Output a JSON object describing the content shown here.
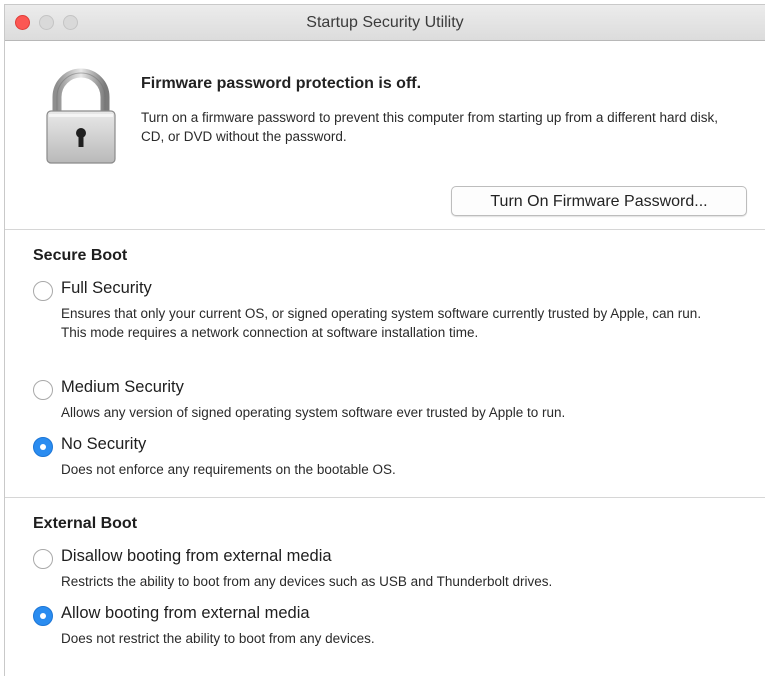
{
  "window": {
    "title": "Startup Security Utility"
  },
  "firmware": {
    "heading": "Firmware password protection is off.",
    "description": "Turn on a firmware password to prevent this computer from starting up from a different hard disk, CD, or DVD without the password.",
    "button_label": "Turn On Firmware Password...",
    "icon": "lock-icon"
  },
  "secure_boot": {
    "title": "Secure Boot",
    "options": [
      {
        "label": "Full Security",
        "description": "Ensures that only your current OS, or signed operating system software currently trusted by Apple, can run. This mode requires a network connection at software installation time.",
        "selected": false
      },
      {
        "label": "Medium Security",
        "description": "Allows any version of signed operating system software ever trusted by Apple to run.",
        "selected": false
      },
      {
        "label": "No Security",
        "description": "Does not enforce any requirements on the bootable OS.",
        "selected": true
      }
    ]
  },
  "external_boot": {
    "title": "External Boot",
    "options": [
      {
        "label": "Disallow booting from external media",
        "description": "Restricts the ability to boot from any devices such as USB and Thunderbolt drives.",
        "selected": false
      },
      {
        "label": "Allow booting from external media",
        "description": "Does not restrict the ability to boot from any devices.",
        "selected": true
      }
    ]
  },
  "colors": {
    "accent": "#2a8cf0",
    "close": "#fc5753"
  }
}
